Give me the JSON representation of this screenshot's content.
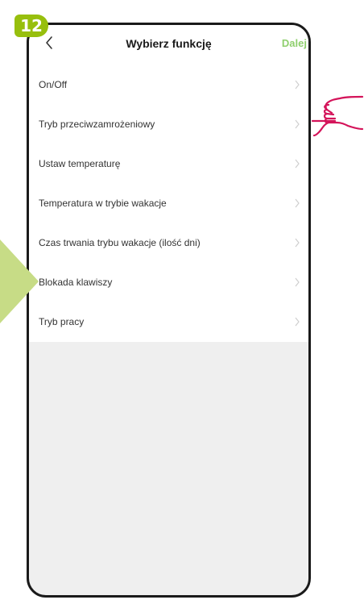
{
  "step": {
    "number": "12"
  },
  "header": {
    "title": "Wybierz funkcję",
    "next_label": "Dalej",
    "back_icon": "chevron-left-icon"
  },
  "functions": {
    "items": [
      {
        "label": "On/Off"
      },
      {
        "label": "Tryb przeciwzamrożeniowy"
      },
      {
        "label": "Ustaw temperaturę"
      },
      {
        "label": "Temperatura w trybie wakacje"
      },
      {
        "label": "Czas trwania trybu wakacje (ilość dni)"
      },
      {
        "label": "Blokada klawiszy"
      },
      {
        "label": "Tryb pracy"
      }
    ],
    "chevron_icon": "chevron-right-icon"
  },
  "annotations": {
    "pointer_icon": "hand-pointer-icon",
    "side_arrow_icon": "arrow-right-icon"
  },
  "colors": {
    "brand_green": "#97bf0d",
    "next_green": "#8fcf6e",
    "pointer_pink": "#d4145a",
    "background_gray": "#efefef",
    "outline": "#1a1a1a"
  }
}
